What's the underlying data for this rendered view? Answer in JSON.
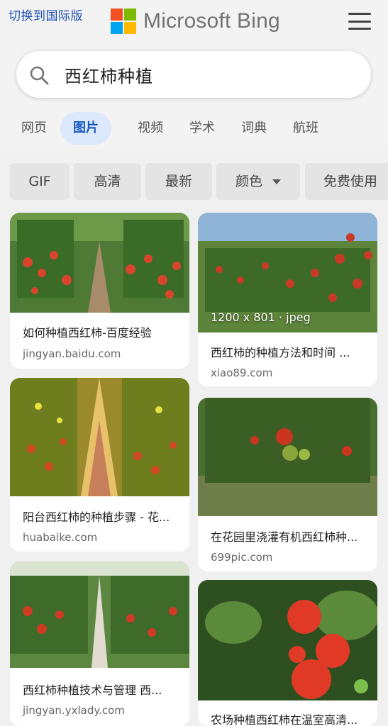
{
  "header": {
    "intl_link": "切换到国际版",
    "brand": "Microsoft Bing",
    "logo_colors": [
      "#f25022",
      "#7fba00",
      "#00a4ef",
      "#ffb900"
    ]
  },
  "search": {
    "query": "西红柿种植"
  },
  "tabs": [
    {
      "label": "网页"
    },
    {
      "label": "图片",
      "active": true
    },
    {
      "label": "视频"
    },
    {
      "label": "学术"
    },
    {
      "label": "词典"
    },
    {
      "label": "航班"
    }
  ],
  "filters": [
    {
      "label": "GIF"
    },
    {
      "label": "高清"
    },
    {
      "label": "最新"
    },
    {
      "label": "颜色"
    },
    {
      "label": "免费使用"
    }
  ],
  "results": [
    {
      "title": "如何种植西红柿-百度经验",
      "source": "jingyan.baidu.com"
    },
    {
      "title": "西红柿的种植方法和时间 ...",
      "source": "xiao89.com",
      "badge": "1200 x 801 · jpeg"
    },
    {
      "title": "阳台西红柿的种植步骤 - 花...",
      "source": "huabaike.com"
    },
    {
      "title": "在花园里浇灌有机西红柿种...",
      "source": "699pic.com"
    },
    {
      "title": "西红柿种植技术与管理 西...",
      "source": "jingyan.yxlady.com"
    },
    {
      "title": "农场种植西红柿在温室高清...",
      "source": ""
    }
  ],
  "colors": {
    "accent": "#1557c0",
    "active_tab_bg": "#dce8fb",
    "link": "#1a4fb5"
  }
}
